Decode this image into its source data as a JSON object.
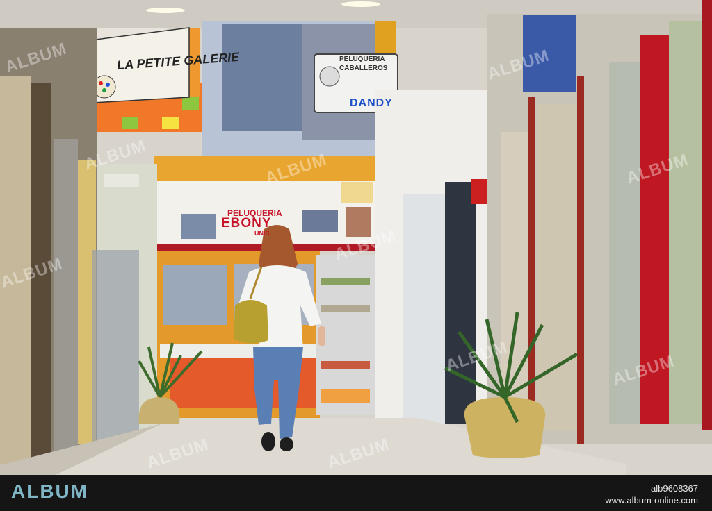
{
  "signs": {
    "galerie": "LA PETITE GALERIE",
    "peluqueria_caballeros_1": "PELUQUERIA",
    "peluqueria_caballeros_2": "CABALLEROS",
    "dandy": "DANDY",
    "peluqueria": "PELUQUERIA",
    "ebony": "EBONY",
    "unis": "UNIS"
  },
  "watermark": {
    "text": "ALBUM"
  },
  "footer": {
    "logo": "ALBUM",
    "image_id": "alb9608367",
    "url": "www.album-online.com"
  },
  "colors": {
    "footer_bg": "#151515",
    "logo": "#7fb5c4",
    "ebony_red": "#c8142a",
    "dandy_blue": "#1e50c8"
  }
}
